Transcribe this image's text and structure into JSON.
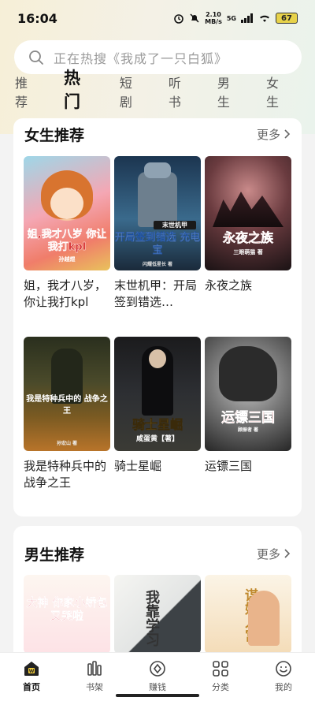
{
  "status": {
    "time": "16:04",
    "net_speed_top": "2.10",
    "net_speed_bottom": "MB/s",
    "signal": "5G",
    "battery": "67"
  },
  "search": {
    "placeholder": "正在热搜《我成了一只白狐》"
  },
  "tabs": [
    "推荐",
    "热门",
    "短剧",
    "听书",
    "男生",
    "女生"
  ],
  "active_tab": "热门",
  "female_section": {
    "title": "女生推荐",
    "more": "更多",
    "books": [
      {
        "title": "姐，我才八岁，你让我打kpl",
        "cover_text": "姐,我才八岁 你让我打kpl",
        "cover_author": "孙越煜"
      },
      {
        "title": "末世机甲：开局签到错选…",
        "cover_text": "开局签到错选 充电宝",
        "cover_badge": "末世机甲",
        "cover_author": "闪耀低星长 著"
      },
      {
        "title": "永夜之族",
        "cover_text": "永夜之族",
        "cover_author": "三眼萌猫 著"
      },
      {
        "title": "我是特种兵中的战争之王",
        "cover_text": "我是特种兵中的 战争之王",
        "cover_author": "孙宏山 著"
      },
      {
        "title": "骑士星崛",
        "cover_text": "骑士星崛",
        "cover_author": "咸蛋黄【著】"
      },
      {
        "title": "运镖三国",
        "cover_text": "运镖三国",
        "cover_author": "顾振者 著"
      }
    ]
  },
  "male_section": {
    "title": "男生推荐",
    "more": "更多",
    "books": [
      {
        "cover_text": "大神 你家小娇包 又哭啦"
      },
      {
        "cover_text": "我靠学习"
      },
      {
        "cover_text": "谋妃入宫"
      }
    ]
  },
  "tabbar": [
    {
      "label": "首页",
      "icon": "home-icon"
    },
    {
      "label": "书架",
      "icon": "bookshelf-icon"
    },
    {
      "label": "赚钱",
      "icon": "earn-icon"
    },
    {
      "label": "分类",
      "icon": "category-icon"
    },
    {
      "label": "我的",
      "icon": "profile-icon"
    }
  ],
  "colors": {
    "accent": "#f4cf3a",
    "background": "#f3f3f3"
  }
}
